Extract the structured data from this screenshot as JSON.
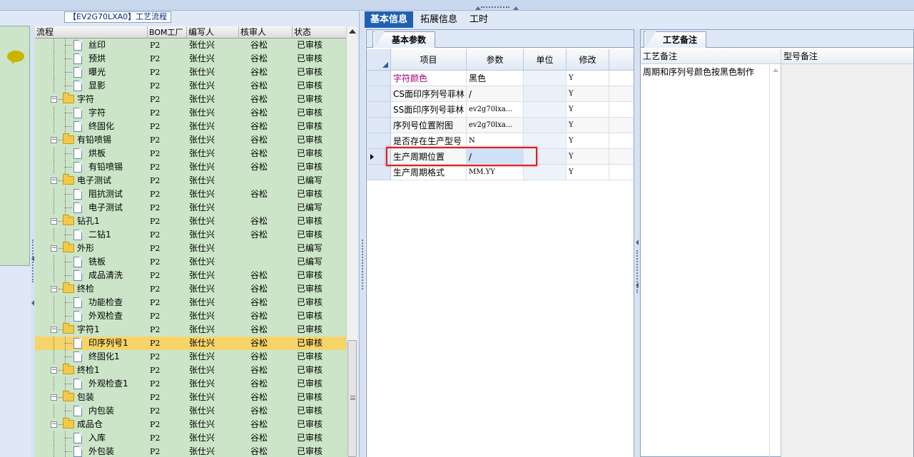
{
  "left_panel": {
    "title": "【EV2G70LXA0】工艺流程",
    "columns": [
      "流程",
      "BOM工厂",
      "编写人",
      "核审人",
      "状态"
    ],
    "rows": [
      {
        "level": 2,
        "type": "doc",
        "name": "丝印",
        "bom": "P2",
        "writer": "张仕兴",
        "reviewer": "谷松",
        "status": "已审核"
      },
      {
        "level": 2,
        "type": "doc",
        "name": "预烘",
        "bom": "P2",
        "writer": "张仕兴",
        "reviewer": "谷松",
        "status": "已审核"
      },
      {
        "level": 2,
        "type": "doc",
        "name": "曝光",
        "bom": "P2",
        "writer": "张仕兴",
        "reviewer": "谷松",
        "status": "已审核"
      },
      {
        "level": 2,
        "type": "doc",
        "name": "显影",
        "bom": "P2",
        "writer": "张仕兴",
        "reviewer": "谷松",
        "status": "已审核"
      },
      {
        "level": 1,
        "type": "folder",
        "name": "字符",
        "bom": "P2",
        "writer": "张仕兴",
        "reviewer": "谷松",
        "status": "已审核"
      },
      {
        "level": 2,
        "type": "doc",
        "name": "字符",
        "bom": "P2",
        "writer": "张仕兴",
        "reviewer": "谷松",
        "status": "已审核"
      },
      {
        "level": 2,
        "type": "doc",
        "name": "终固化",
        "bom": "P2",
        "writer": "张仕兴",
        "reviewer": "谷松",
        "status": "已审核"
      },
      {
        "level": 1,
        "type": "folder",
        "name": "有铅喷锡",
        "bom": "P2",
        "writer": "张仕兴",
        "reviewer": "谷松",
        "status": "已审核"
      },
      {
        "level": 2,
        "type": "doc",
        "name": "烘板",
        "bom": "P2",
        "writer": "张仕兴",
        "reviewer": "谷松",
        "status": "已审核"
      },
      {
        "level": 2,
        "type": "doc",
        "name": "有铅喷锡",
        "bom": "P2",
        "writer": "张仕兴",
        "reviewer": "谷松",
        "status": "已审核"
      },
      {
        "level": 1,
        "type": "folder",
        "name": "电子测试",
        "bom": "P2",
        "writer": "张仕兴",
        "reviewer": "",
        "status": "已编写"
      },
      {
        "level": 2,
        "type": "doc",
        "name": "阻抗测试",
        "bom": "P2",
        "writer": "张仕兴",
        "reviewer": "谷松",
        "status": "已审核"
      },
      {
        "level": 2,
        "type": "doc",
        "name": "电子测试",
        "bom": "P2",
        "writer": "张仕兴",
        "reviewer": "",
        "status": "已编写"
      },
      {
        "level": 1,
        "type": "folder",
        "name": "钻孔1",
        "bom": "P2",
        "writer": "张仕兴",
        "reviewer": "谷松",
        "status": "已审核"
      },
      {
        "level": 2,
        "type": "doc",
        "name": "二钻1",
        "bom": "P2",
        "writer": "张仕兴",
        "reviewer": "谷松",
        "status": "已审核"
      },
      {
        "level": 1,
        "type": "folder",
        "name": "外形",
        "bom": "P2",
        "writer": "张仕兴",
        "reviewer": "",
        "status": "已编写"
      },
      {
        "level": 2,
        "type": "doc",
        "name": "铣板",
        "bom": "P2",
        "writer": "张仕兴",
        "reviewer": "",
        "status": "已编写"
      },
      {
        "level": 2,
        "type": "doc",
        "name": "成品清洗",
        "bom": "P2",
        "writer": "张仕兴",
        "reviewer": "谷松",
        "status": "已审核"
      },
      {
        "level": 1,
        "type": "folder",
        "name": "终检",
        "bom": "P2",
        "writer": "张仕兴",
        "reviewer": "谷松",
        "status": "已审核"
      },
      {
        "level": 2,
        "type": "doc",
        "name": "功能检查",
        "bom": "P2",
        "writer": "张仕兴",
        "reviewer": "谷松",
        "status": "已审核"
      },
      {
        "level": 2,
        "type": "doc",
        "name": "外观检查",
        "bom": "P2",
        "writer": "张仕兴",
        "reviewer": "谷松",
        "status": "已审核"
      },
      {
        "level": 1,
        "type": "folder",
        "name": "字符1",
        "bom": "P2",
        "writer": "张仕兴",
        "reviewer": "谷松",
        "status": "已审核"
      },
      {
        "level": 2,
        "type": "doc",
        "name": "印序列号1",
        "bom": "P2",
        "writer": "张仕兴",
        "reviewer": "谷松",
        "status": "已审核",
        "selected": true
      },
      {
        "level": 2,
        "type": "doc",
        "name": "终固化1",
        "bom": "P2",
        "writer": "张仕兴",
        "reviewer": "谷松",
        "status": "已审核"
      },
      {
        "level": 1,
        "type": "folder",
        "name": "终检1",
        "bom": "P2",
        "writer": "张仕兴",
        "reviewer": "谷松",
        "status": "已审核"
      },
      {
        "level": 2,
        "type": "doc",
        "name": "外观检查1",
        "bom": "P2",
        "writer": "张仕兴",
        "reviewer": "谷松",
        "status": "已审核"
      },
      {
        "level": 1,
        "type": "folder",
        "name": "包装",
        "bom": "P2",
        "writer": "张仕兴",
        "reviewer": "谷松",
        "status": "已审核"
      },
      {
        "level": 2,
        "type": "doc",
        "name": "内包装",
        "bom": "P2",
        "writer": "张仕兴",
        "reviewer": "谷松",
        "status": "已审核"
      },
      {
        "level": 1,
        "type": "folder",
        "name": "成品仓",
        "bom": "P2",
        "writer": "张仕兴",
        "reviewer": "谷松",
        "status": "已审核"
      },
      {
        "level": 2,
        "type": "doc",
        "name": "入库",
        "bom": "P2",
        "writer": "张仕兴",
        "reviewer": "谷松",
        "status": "已审核"
      },
      {
        "level": 2,
        "type": "doc",
        "name": "外包装",
        "bom": "P2",
        "writer": "张仕兴",
        "reviewer": "谷松",
        "status": "已审核"
      }
    ]
  },
  "tabs": [
    {
      "label": "基本信息",
      "active": true
    },
    {
      "label": "拓展信息",
      "active": false
    },
    {
      "label": "工时",
      "active": false
    }
  ],
  "basic_params": {
    "tab_label": "基本参数",
    "columns": [
      "项目",
      "参数",
      "单位",
      "修改"
    ],
    "rows": [
      {
        "item": "字符颜色",
        "value": "黑色",
        "unit": "",
        "modify": "Y",
        "highlight_color": "#a0006e"
      },
      {
        "item": "CS面印序列号菲林",
        "value": "/",
        "unit": "",
        "modify": "Y"
      },
      {
        "item": "SS面印序列号菲林",
        "value": "ev2g70lxa...",
        "unit": "",
        "modify": "Y"
      },
      {
        "item": "序列号位置附图",
        "value": "ev2g70lxa...",
        "unit": "",
        "modify": "Y"
      },
      {
        "item": "是否存在生产型号",
        "value": "N",
        "unit": "",
        "modify": "Y"
      },
      {
        "item": "生产周期位置",
        "value": "/",
        "unit": "",
        "modify": "Y",
        "current": true
      },
      {
        "item": "生产周期格式",
        "value": "MM.YY",
        "unit": "",
        "modify": "Y"
      }
    ]
  },
  "notes": {
    "tab_label": "工艺备注",
    "columns": [
      "工艺备注",
      "型号备注"
    ],
    "process_note": "周期和序列号颜色按黑色制作",
    "model_note": ""
  },
  "colors": {
    "accent": "#2060b0",
    "tree_bg": "#cce5c8",
    "selected_row": "#f6d46a",
    "annotation": "#dd2222"
  }
}
